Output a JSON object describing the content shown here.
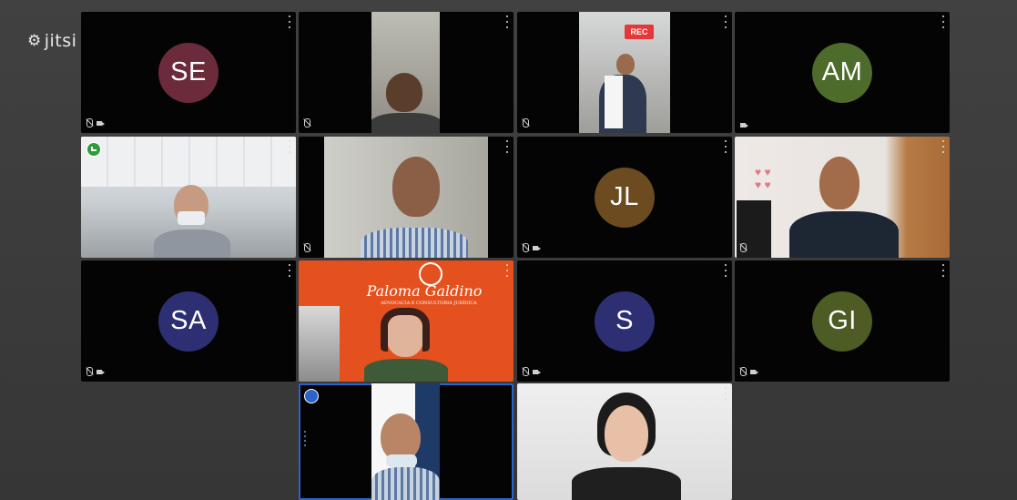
{
  "app": {
    "logo_text": "jitsi",
    "logo_glyph": "⚙"
  },
  "recording": {
    "label": "REC",
    "color": "#e4373a"
  },
  "tiles": {
    "se": {
      "initials": "SE",
      "color": "#6b2b3b"
    },
    "am": {
      "initials": "AM",
      "color": "#4d6b2a"
    },
    "jl": {
      "initials": "JL",
      "color": "#6b4b1f"
    },
    "sa": {
      "initials": "SA",
      "color": "#2d2f72"
    },
    "s": {
      "initials": "S",
      "color": "#2d2f72"
    },
    "gi": {
      "initials": "GI",
      "color": "#4d5b25"
    }
  },
  "sign": {
    "name": "Paloma Galdino",
    "subtitle": "ADVOCACIA E CONSULTORIA JURÍDICA"
  },
  "icons": {
    "mic": "microphone-off-icon",
    "camera": "camera-off-icon",
    "menu": "more-vertical-icon",
    "signal": "connection-status-icon",
    "local": "local-user-icon"
  },
  "colors": {
    "background": "#3a3a3a",
    "tile": "#040404",
    "active_border": "#2b64c8",
    "connection_good": "#2f9b3a"
  }
}
